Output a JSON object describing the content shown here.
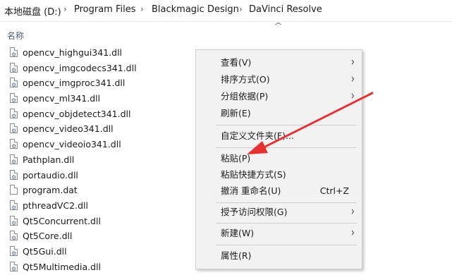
{
  "breadcrumb": {
    "items": [
      {
        "label": "本地磁盘 (D:)"
      },
      {
        "label": "Program Files"
      },
      {
        "label": "Blackmagic Design"
      },
      {
        "label": "DaVinci Resolve"
      }
    ],
    "separator": "›"
  },
  "list": {
    "column_name_header": "名称",
    "sort_icon": "chevron-up-icon",
    "files": [
      {
        "name": "opencv_highgui341.dll",
        "icon": "dll-file-icon"
      },
      {
        "name": "opencv_imgcodecs341.dll",
        "icon": "dll-file-icon"
      },
      {
        "name": "opencv_imgproc341.dll",
        "icon": "dll-file-icon"
      },
      {
        "name": "opencv_ml341.dll",
        "icon": "dll-file-icon"
      },
      {
        "name": "opencv_objdetect341.dll",
        "icon": "dll-file-icon"
      },
      {
        "name": "opencv_video341.dll",
        "icon": "dll-file-icon"
      },
      {
        "name": "opencv_videoio341.dll",
        "icon": "dll-file-icon"
      },
      {
        "name": "Pathplan.dll",
        "icon": "dll-file-icon"
      },
      {
        "name": "portaudio.dll",
        "icon": "dll-file-icon"
      },
      {
        "name": "program.dat",
        "icon": "file-icon"
      },
      {
        "name": "pthreadVC2.dll",
        "icon": "dll-file-icon"
      },
      {
        "name": "Qt5Concurrent.dll",
        "icon": "dll-file-icon"
      },
      {
        "name": "Qt5Core.dll",
        "icon": "dll-file-icon"
      },
      {
        "name": "Qt5Gui.dll",
        "icon": "dll-file-icon"
      },
      {
        "name": "Qt5Multimedia.dll",
        "icon": "dll-file-icon"
      }
    ]
  },
  "context_menu": {
    "items": [
      {
        "label": "查看(V)",
        "submenu": true
      },
      {
        "label": "排序方式(O)",
        "submenu": true
      },
      {
        "label": "分组依据(P)",
        "submenu": true
      },
      {
        "label": "刷新(E)"
      },
      {
        "label": "自定义文件夹(F)..."
      },
      {
        "label": "粘贴(P)"
      },
      {
        "label": "粘贴快捷方式(S)"
      },
      {
        "label": "撤消 重命名(U)",
        "shortcut": "Ctrl+Z"
      },
      {
        "label": "授予访问权限(G)",
        "submenu": true
      },
      {
        "label": "新建(W)",
        "submenu": true
      },
      {
        "label": "属性(R)"
      }
    ],
    "submenu_arrow": "›"
  },
  "annotation": {
    "arrow_color": "#e8312f",
    "points_to": "粘贴(P)"
  }
}
